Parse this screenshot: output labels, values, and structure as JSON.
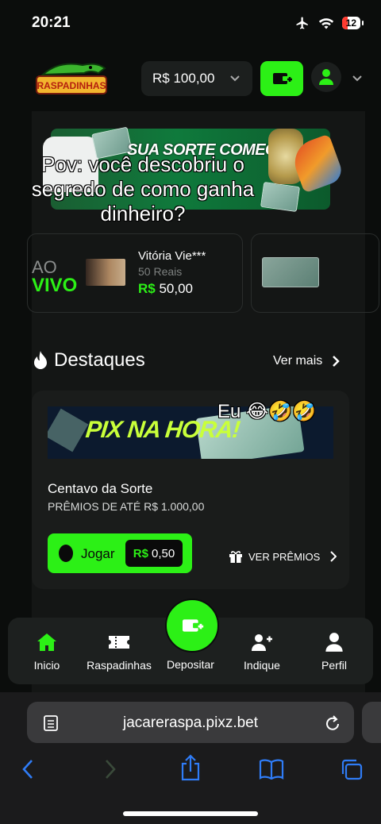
{
  "status": {
    "time": "20:21",
    "battery": "12"
  },
  "header": {
    "logo_text": "RASPADINHAS",
    "balance": "R$ 100,00"
  },
  "banner": {
    "headline": "SUA SORTE COMEÇA"
  },
  "overlay": {
    "caption": "Pov: você descobriu o segredo de como ganha dinheiro?"
  },
  "live": {
    "ao": "AO",
    "vivo": "VIVO",
    "winner_name": "Vitória Vie***",
    "winner_prize": "50 Reais",
    "currency": "R$",
    "winner_amount": "50,00"
  },
  "highlights": {
    "title": "Destaques",
    "see_more": "Ver mais",
    "game": {
      "banner_text": "PIX NA HORA!",
      "caption_overlay": "Eu 😂🤣🤣",
      "name": "Centavo da Sorte",
      "subtitle": "PRÊMIOS DE ATÉ R$ 1.000,00",
      "play_label": "Jogar",
      "price_currency": "R$",
      "price": "0,50",
      "see_prizes": "VER PRÊMIOS"
    }
  },
  "nav": {
    "inicio": "Inicio",
    "raspadinhas": "Raspadinhas",
    "depositar": "Depositar",
    "indique": "Indique",
    "perfil": "Perfil"
  },
  "browser": {
    "url": "jacareraspa.pixz.bet"
  },
  "colors": {
    "accent": "#2cf016",
    "background": "#0b0d0c",
    "card": "#1a1c1b"
  }
}
